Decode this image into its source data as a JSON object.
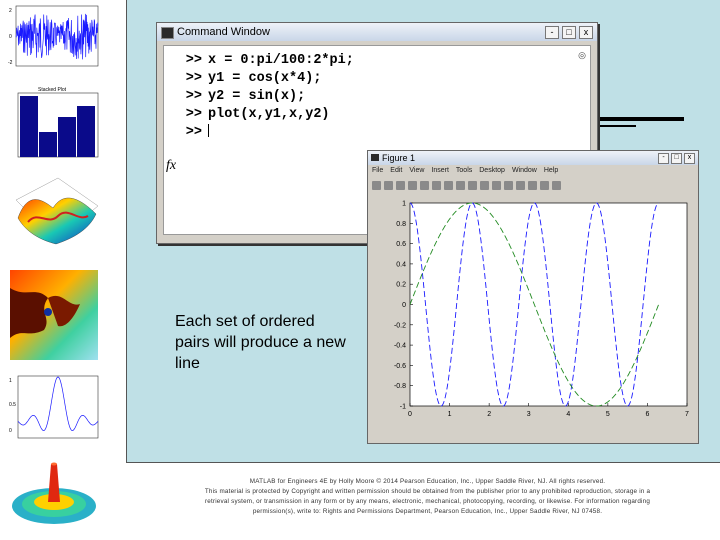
{
  "command_window": {
    "title": "Command Window",
    "prompt": ">>",
    "fx_label": "fx",
    "lines": [
      "x = 0:pi/100:2*pi;",
      "y1 = cos(x*4);",
      "y2 = sin(x);",
      "plot(x,y1,x,y2)"
    ],
    "buttons": [
      "-",
      "□",
      "x"
    ]
  },
  "figure_window": {
    "title": "Figure 1",
    "menu": [
      "File",
      "Edit",
      "View",
      "Insert",
      "Tools",
      "Desktop",
      "Window",
      "Help"
    ],
    "buttons": [
      "-",
      "□",
      "x"
    ]
  },
  "slide": {
    "text": "Each set of ordered pairs will produce a new line"
  },
  "footer": {
    "line1": "MATLAB for Engineers 4E by Holly Moore © 2014 Pearson Education, Inc., Upper Saddle River, NJ. All rights reserved.",
    "line2": "This material is protected by Copyright and written permission should be obtained from the publisher prior to any prohibited reproduction, storage in a",
    "line3": "retrieval system, or transmission in any form or by any means, electronic, mechanical, photocopying, recording, or likewise. For information regarding",
    "line4": "permission(s), write to: Rights and Permissions Department, Pearson Education, Inc., Upper Saddle River, NJ 07458."
  },
  "sidebar": {
    "thumb2_title": "Stacked Plot"
  },
  "chart_data": {
    "type": "line",
    "x_range": [
      0,
      7
    ],
    "ylim": [
      -1,
      1
    ],
    "x_ticks": [
      0,
      1,
      2,
      3,
      4,
      5,
      6,
      7
    ],
    "y_ticks": [
      "1",
      "0.8",
      "0.6",
      "0.4",
      "0.2",
      "0",
      "-0.2",
      "-0.4",
      "-0.6",
      "-0.8",
      "-1"
    ],
    "series": [
      {
        "expr": "cos(4x)",
        "color": "#1a1aff",
        "style": "dashed"
      },
      {
        "expr": "sin(x)",
        "color": "#228b22",
        "style": "dashed"
      }
    ]
  },
  "colors": {
    "slide_bg": "#bfe0e6",
    "window_chrome": "#d4d0c8"
  }
}
